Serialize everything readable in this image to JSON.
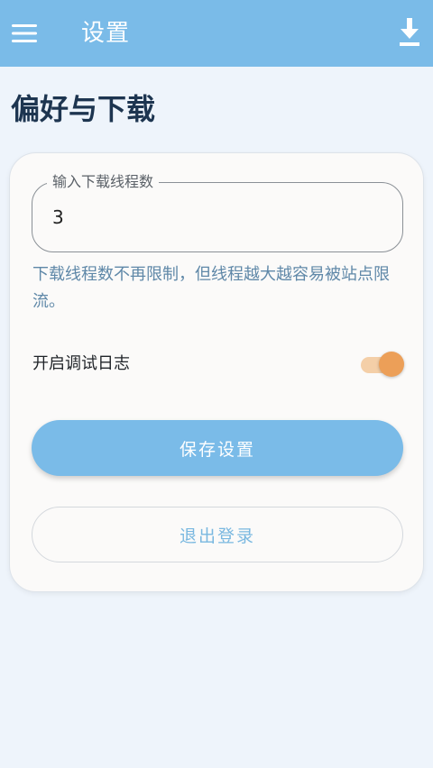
{
  "appbar": {
    "title": "设置",
    "menu_icon": "hamburger-menu-icon",
    "download_icon": "download-icon",
    "background_color": "#7abbe8"
  },
  "page": {
    "heading": "偏好与下载"
  },
  "settings": {
    "threads_field": {
      "label": "输入下载线程数",
      "value": "3"
    },
    "hint": "下载线程数不再限制，但线程越大越容易被站点限流。",
    "debug_log": {
      "label": "开启调试日志",
      "enabled": true,
      "accent_color": "#ec9f58"
    },
    "save_label": "保存设置",
    "logout_label": "退出登录"
  }
}
